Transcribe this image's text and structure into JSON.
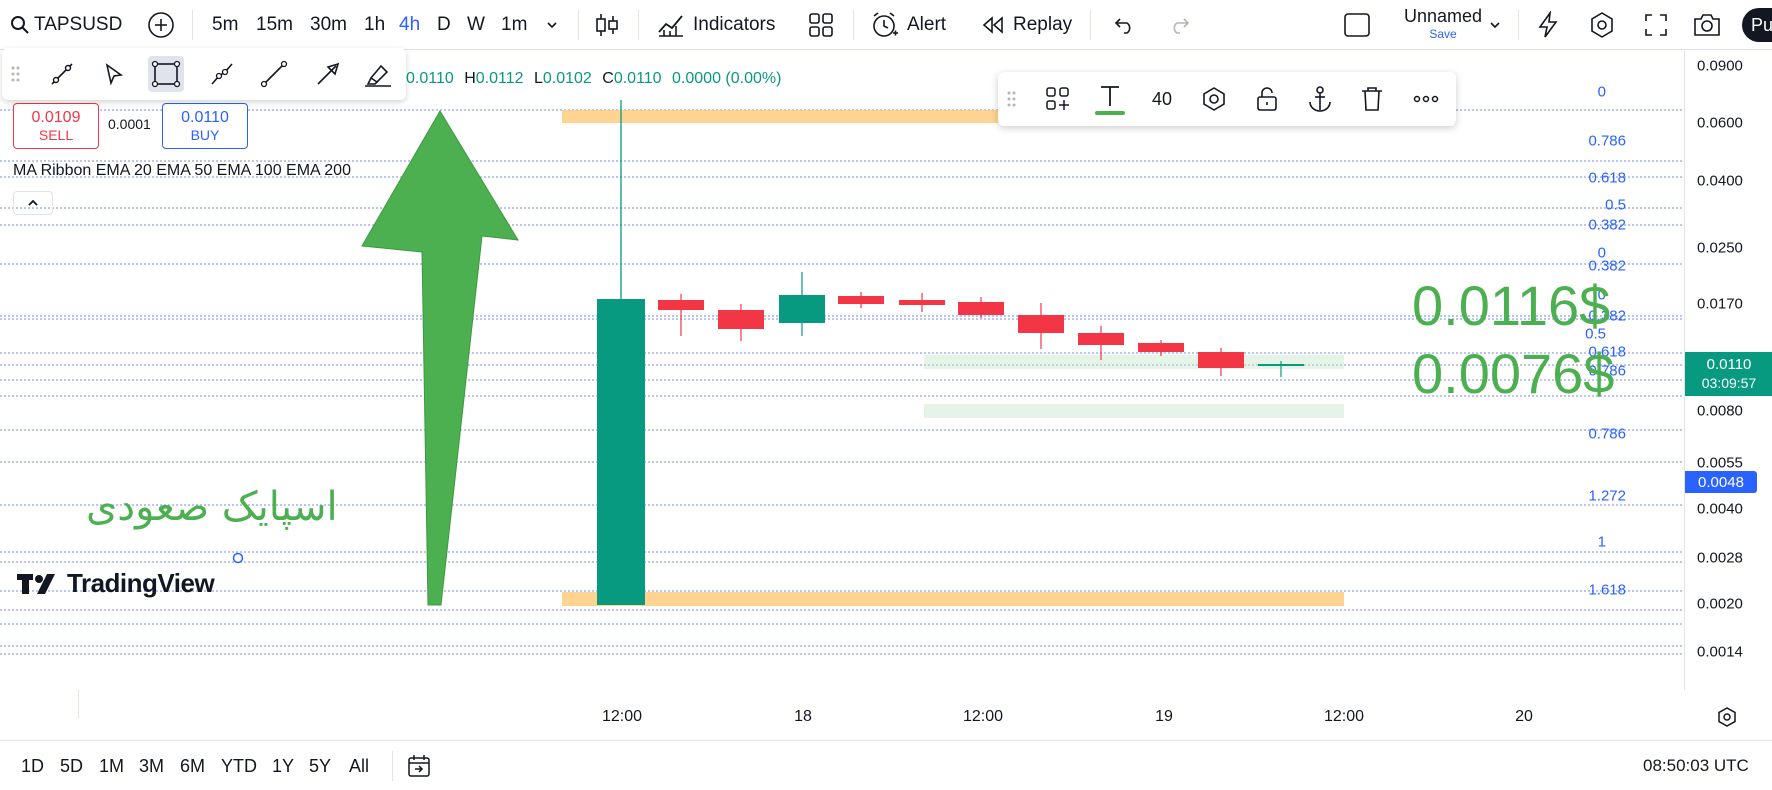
{
  "header": {
    "symbol": "TAPSUSD",
    "intervals": [
      "5m",
      "15m",
      "30m",
      "1h",
      "4h",
      "D",
      "W",
      "1m"
    ],
    "active_interval": "4h",
    "indicators_label": "Indicators",
    "alert_label": "Alert",
    "replay_label": "Replay",
    "layout_name": "Unnamed",
    "save_label": "Save",
    "publish_label": "Pu"
  },
  "legend": {
    "o_value": "0.0110",
    "h_label": "H",
    "h_value": "0.0112",
    "l_label": "L",
    "l_value": "0.0102",
    "c_label": "C",
    "c_value": "0.0110",
    "change": "0.0000 (0.00%)",
    "sell_price": "0.0109",
    "sell_label": "SELL",
    "spread": "0.0001",
    "buy_price": "0.0110",
    "buy_label": "BUY",
    "indicator_name": "MA Ribbon EMA 20 EMA 50 EMA 100 EMA 200"
  },
  "float_toolbar": {
    "font_size": "40"
  },
  "price_axis": {
    "ticks": [
      "0.0900",
      "0.0600",
      "0.0400",
      "0.0250",
      "0.0170",
      "0.0080",
      "0.0055",
      "0.0040",
      "0.0028",
      "0.0020",
      "0.0014"
    ],
    "current_price": "0.0110",
    "countdown": "03:09:57",
    "marker_price": "0.0048",
    "current_color": "#089981",
    "marker_color": "#2962ff"
  },
  "fib_labels": [
    "0",
    "0.786",
    "0.618",
    "0.5",
    "0.382",
    "0",
    "0.382",
    "0",
    "0.382",
    "0.5",
    "0.618",
    "0.786",
    "0.786",
    "1.272",
    "1",
    "1.618"
  ],
  "annotations": {
    "price_text_1": "0.0116$",
    "price_text_2": "0.0076$",
    "persian_text": "اسپایک صعودی",
    "text_color": "#4caf50"
  },
  "watermark": "TradingView",
  "time_axis": {
    "labels": [
      "12:00",
      "18",
      "12:00",
      "19",
      "12:00",
      "20"
    ]
  },
  "bottom_bar": {
    "ranges": [
      "1D",
      "5D",
      "1M",
      "3M",
      "6M",
      "YTD",
      "1Y",
      "5Y",
      "All"
    ],
    "clock": "08:50:03 UTC"
  },
  "colors": {
    "up": "#089981",
    "down": "#f23645",
    "accent": "#2962ff",
    "fib_band": "#ffcc80"
  }
}
